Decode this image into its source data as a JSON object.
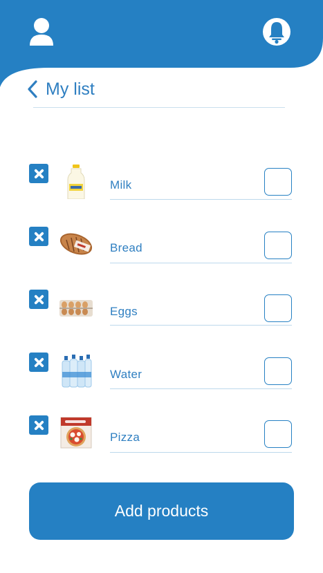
{
  "colors": {
    "primary": "#2580c3",
    "text": "#2f7fc1",
    "divider": "#bcd8ec",
    "background": "#ffffff"
  },
  "header": {
    "left_icon": "user-icon",
    "right_icon": "bell-icon"
  },
  "page": {
    "back_icon": "chevron-left-icon",
    "title": "My list"
  },
  "items": [
    {
      "label": "Milk",
      "image": "milk-bottle-image",
      "checked": false
    },
    {
      "label": "Bread",
      "image": "bread-loaf-image",
      "checked": false
    },
    {
      "label": "Eggs",
      "image": "egg-carton-image",
      "checked": false
    },
    {
      "label": "Water",
      "image": "water-bottles-image",
      "checked": false
    },
    {
      "label": "Pizza",
      "image": "pizza-box-image",
      "checked": false
    }
  ],
  "actions": {
    "add_label": "Add products"
  }
}
